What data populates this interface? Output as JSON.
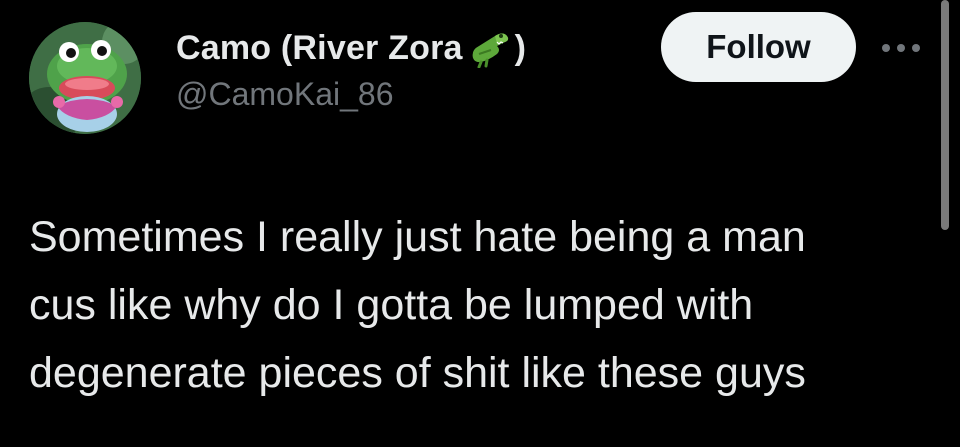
{
  "author": {
    "display_name": "Camo (River Zora",
    "display_name_close": ")",
    "emoji": "crocodile-emoji",
    "handle": "@CamoKai_86",
    "avatar": "frog-character-avatar"
  },
  "actions": {
    "follow_label": "Follow",
    "more_icon": "more-horizontal-icon"
  },
  "tweet": {
    "lines": [
      "Sometimes I really just hate being a man",
      "cus like why do I gotta be lumped with",
      "degenerate pieces of shit like these guys"
    ]
  },
  "colors": {
    "background": "#000000",
    "primary_text": "#e7e9ea",
    "secondary_text": "#71767b",
    "follow_button_bg": "#eff3f4",
    "follow_button_text": "#0f1419"
  }
}
